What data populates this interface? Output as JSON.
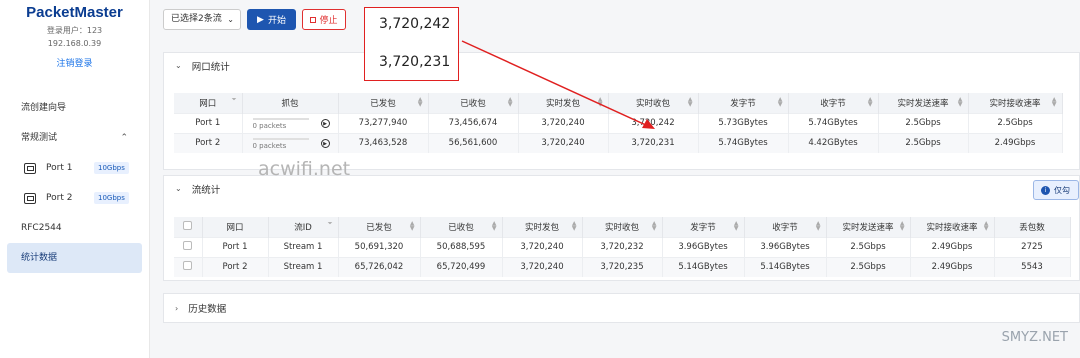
{
  "app": {
    "name": "PacketMaster",
    "user_line": "登录用户：123",
    "ip": "192.168.0.39",
    "logout": "注销登录"
  },
  "sidebar": {
    "wizard": "流创建向导",
    "regular": "常规测试",
    "ports": [
      {
        "label": "Port 1",
        "speed": "10Gbps"
      },
      {
        "label": "Port 2",
        "speed": "10Gbps"
      }
    ],
    "rfc": "RFC2544",
    "stats": "统计数据"
  },
  "toolbar": {
    "select": "已选择2条流",
    "start": "开始",
    "stop": "停止"
  },
  "callout": {
    "v1": "3,720,242",
    "v2": "3,720,231"
  },
  "port_stats": {
    "title": "网口统计",
    "headers": [
      "网口",
      "抓包",
      "已发包",
      "已收包",
      "实时发包",
      "实时收包",
      "发字节",
      "收字节",
      "实时发送速率",
      "实时接收速率"
    ],
    "rows": [
      {
        "port": "Port 1",
        "capture": "0 packets",
        "tx": "73,277,940",
        "rx": "73,456,674",
        "rt_tx": "3,720,240",
        "rt_rx": "3,720,242",
        "tx_bytes": "5.73GBytes",
        "rx_bytes": "5.74GBytes",
        "tx_rate": "2.5Gbps",
        "rx_rate": "2.5Gbps"
      },
      {
        "port": "Port 2",
        "capture": "0 packets",
        "tx": "73,463,528",
        "rx": "56,561,600",
        "rt_tx": "3,720,240",
        "rt_rx": "3,720,231",
        "tx_bytes": "5.74GBytes",
        "rx_bytes": "4.42GBytes",
        "tx_rate": "2.5Gbps",
        "rx_rate": "2.49Gbps"
      }
    ]
  },
  "stream_stats": {
    "title": "流统计",
    "info_btn": "仅勾",
    "headers": [
      "网口",
      "流ID",
      "已发包",
      "已收包",
      "实时发包",
      "实时收包",
      "发字节",
      "收字节",
      "实时发送速率",
      "实时接收速率",
      "丢包数"
    ],
    "rows": [
      {
        "port": "Port 1",
        "stream": "Stream 1",
        "tx": "50,691,320",
        "rx": "50,688,595",
        "rt_tx": "3,720,240",
        "rt_rx": "3,720,232",
        "tx_bytes": "3.96GBytes",
        "rx_bytes": "3.96GBytes",
        "tx_rate": "2.5Gbps",
        "rx_rate": "2.49Gbps",
        "loss": "2725"
      },
      {
        "port": "Port 2",
        "stream": "Stream 1",
        "tx": "65,726,042",
        "rx": "65,720,499",
        "rt_tx": "3,720,240",
        "rt_rx": "3,720,235",
        "tx_bytes": "5.14GBytes",
        "rx_bytes": "5.14GBytes",
        "tx_rate": "2.5Gbps",
        "rx_rate": "2.49Gbps",
        "loss": "5543"
      }
    ]
  },
  "history": {
    "title": "历史数据"
  },
  "watermarks": {
    "w1": "acwifi.net",
    "w2": "SMYZ.NET"
  },
  "colors": {
    "accent": "#1e56b0",
    "danger": "#e03030",
    "annotation": "#e02020"
  }
}
